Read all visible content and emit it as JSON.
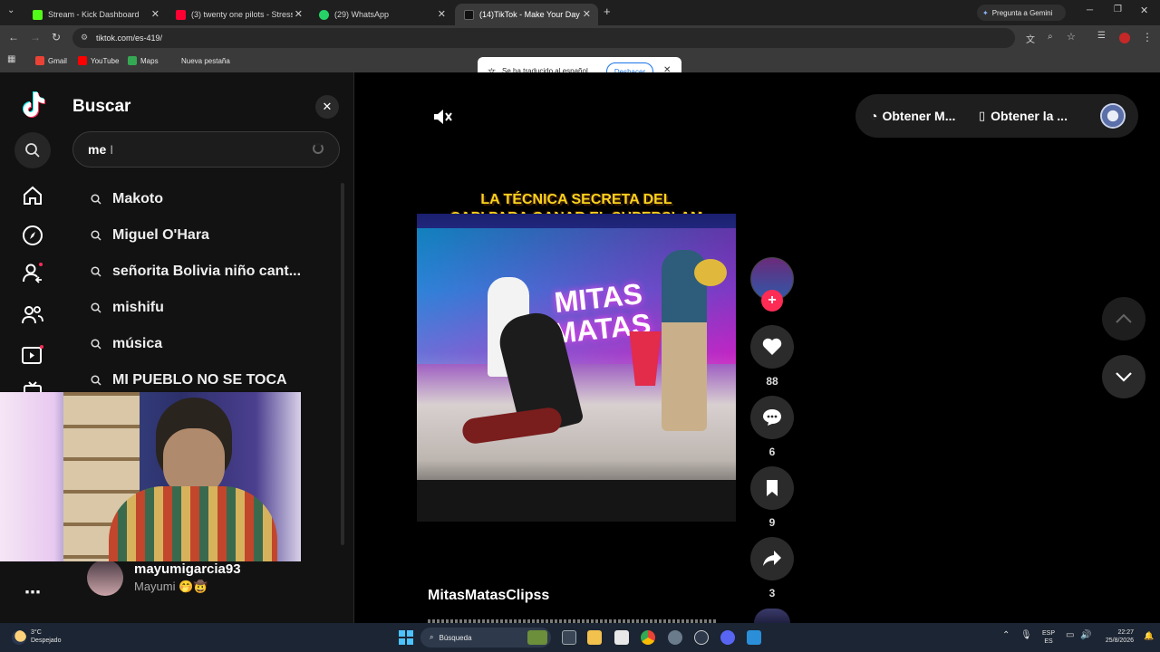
{
  "browser": {
    "tabs": [
      {
        "title": "Stream - Kick Dashboard",
        "color": "#53fc18"
      },
      {
        "title": "(3) twenty one pilots - Stressed",
        "color": "#ff0033"
      },
      {
        "title": "(29) WhatsApp",
        "color": "#25d366"
      },
      {
        "title": "(14)TikTok - Make Your Day",
        "color": "#ffffff"
      }
    ],
    "gemini_label": "Pregunta a Gemini",
    "url": "tiktok.com/es-419/",
    "bookmarks": [
      "Gmail",
      "YouTube",
      "Maps",
      "Nueva pestaña"
    ],
    "translate_message": "Se ha traducido al español",
    "translate_undo": "Deshacer"
  },
  "search_panel": {
    "title": "Buscar",
    "query": "me",
    "suggestions": [
      "Makoto",
      "Miguel O'Hara",
      "señorita Bolivia niño cant...",
      "mishifu",
      "música",
      "MI PUEBLO NO SE TOCA"
    ]
  },
  "account": {
    "username": "mayumigarcia93",
    "display_name": "Mayumi 🤭🤠"
  },
  "video": {
    "caption_line1": "LA TÉCNICA SECRETA DEL",
    "caption_line2": "CAPI PARA GANAR EL SUPERSLAM",
    "caption_emojis": "😂😂😂😂",
    "set_sign_1": "MITAS",
    "set_sign_2": "MATAS",
    "author": "MitasMatasClipss",
    "likes": "88",
    "comments": "6",
    "saves": "9",
    "shares": "3"
  },
  "header_buttons": {
    "get_1": "Obtener M...",
    "get_2": "Obtener la ..."
  },
  "taskbar": {
    "temperature": "3°C",
    "weather": "Despejado",
    "search": "Búsqueda",
    "lang_1": "ESP",
    "lang_2": "ES",
    "time": "22:27",
    "date": "25/8/2026"
  },
  "colors": {
    "tiktok_red": "#fe2c55",
    "caption_yellow": "#f7d31e",
    "accent_blue": "#1a73e8"
  }
}
